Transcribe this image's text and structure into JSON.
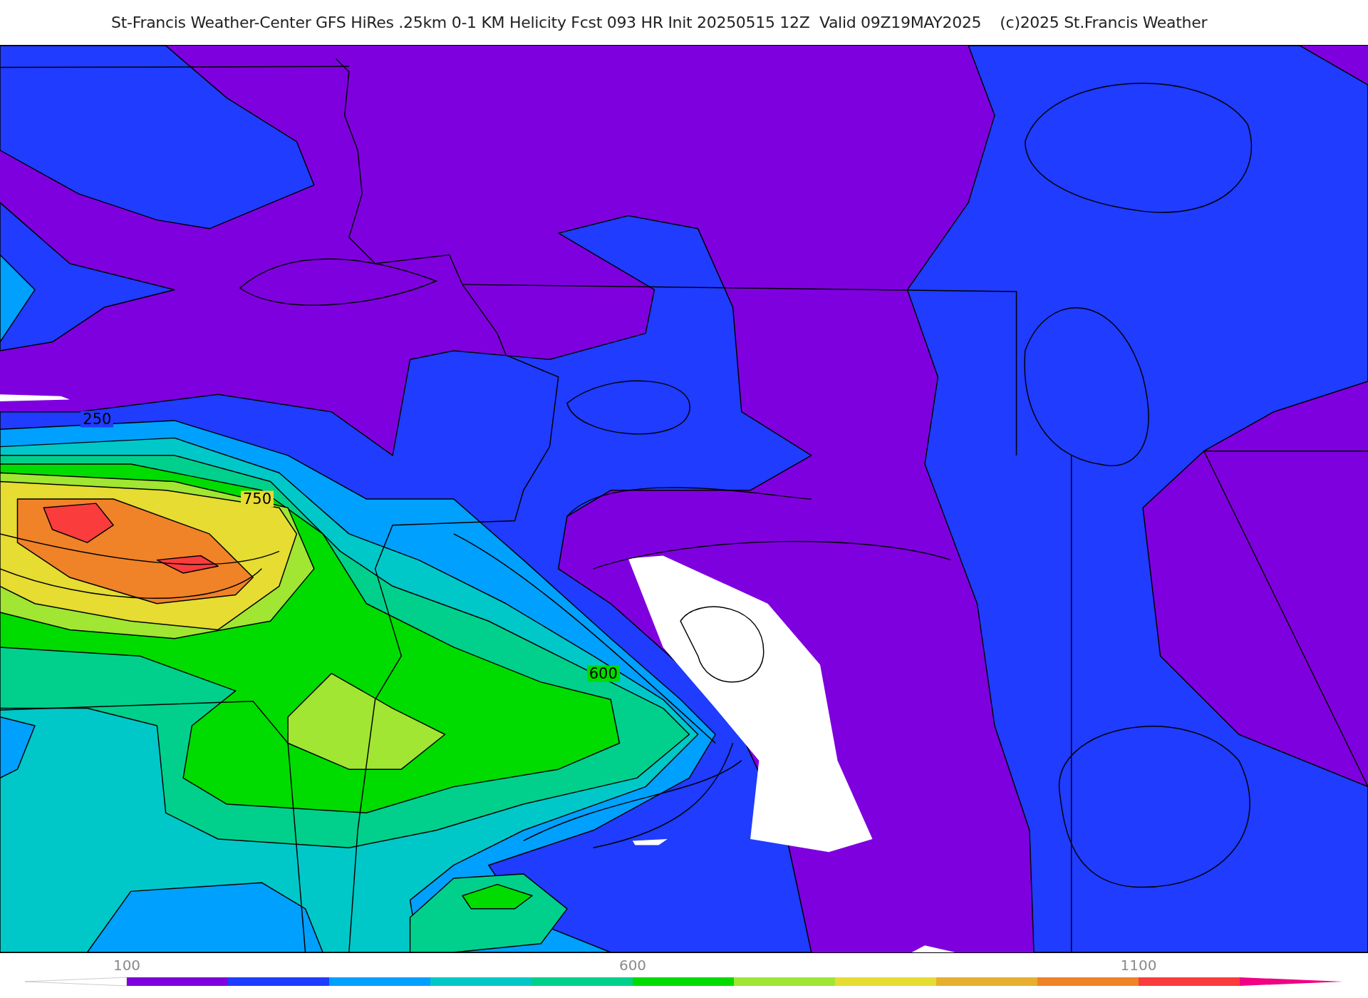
{
  "title": {
    "product": "St-Francis Weather-Center GFS HiRes .25km 0-1 KM Helicity Fcst 093 HR Init 20250515 12Z  Valid 09Z19MAY2025",
    "copyright": "(c)2025 St.Francis Weather"
  },
  "map": {
    "contour_labels": [
      "250",
      "750",
      "600"
    ]
  },
  "colorbar": {
    "labels": [
      "100",
      "600",
      "1100"
    ],
    "segments": [
      {
        "kind": "under",
        "color": "#ffffff"
      },
      {
        "kind": "band",
        "color": "#7f00df"
      },
      {
        "color": "#1f3cff"
      },
      {
        "color": "#00a0ff"
      },
      {
        "color": "#00c8c8"
      },
      {
        "color": "#00d08c"
      },
      {
        "color": "#00dc00"
      },
      {
        "color": "#a0e632"
      },
      {
        "color": "#e6dc32"
      },
      {
        "color": "#e6af2d"
      },
      {
        "color": "#f08228"
      },
      {
        "color": "#fa3c3c"
      },
      {
        "kind": "over",
        "color": "#f00082"
      }
    ]
  }
}
